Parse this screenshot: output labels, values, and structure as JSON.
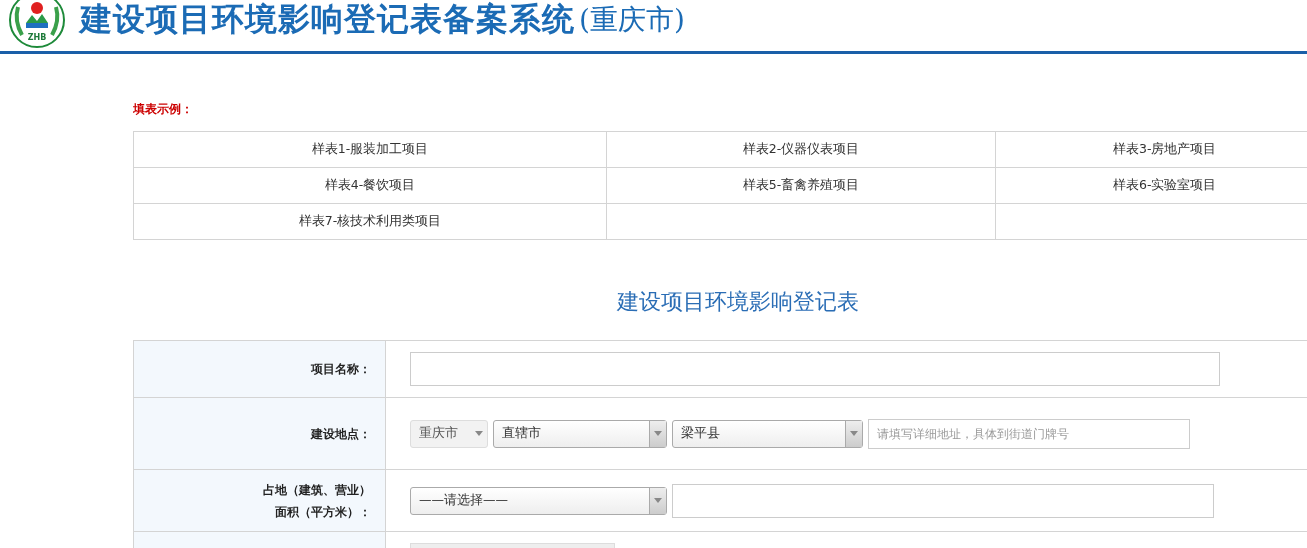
{
  "header": {
    "logo_text": "ZHB",
    "title": "建设项目环境影响登记表备案系统",
    "title_suffix": "(重庆市)"
  },
  "samples": {
    "label": "填表示例：",
    "items": [
      "样表1-服装加工项目",
      "样表2-仪器仪表项目",
      "样表3-房地产项目",
      "样表4-餐饮项目",
      "样表5-畜禽养殖项目",
      "样表6-实验室项目",
      "样表7-核技术利用类项目"
    ]
  },
  "form": {
    "title": "建设项目环境影响登记表",
    "rows": [
      {
        "label": "项目名称：",
        "controls": [
          {
            "kind": "input"
          }
        ]
      },
      {
        "label": "建设地点：",
        "controls": [
          {
            "kind": "select",
            "value": "重庆市",
            "disabled": true
          },
          {
            "kind": "select",
            "value": "直辖市",
            "disabled": false
          },
          {
            "kind": "select",
            "value": "梁平县",
            "disabled": false
          },
          {
            "kind": "input",
            "placeholder": "请填写详细地址，具体到街道门牌号"
          }
        ]
      },
      {
        "label_lines": [
          "占地（建筑、营业）",
          "面积（平方米）："
        ],
        "controls": [
          {
            "kind": "select",
            "value": "——请选择——",
            "disabled": false
          },
          {
            "kind": "input"
          }
        ]
      },
      {
        "controls": [
          {
            "kind": "input",
            "disabled": true
          }
        ]
      }
    ]
  }
}
